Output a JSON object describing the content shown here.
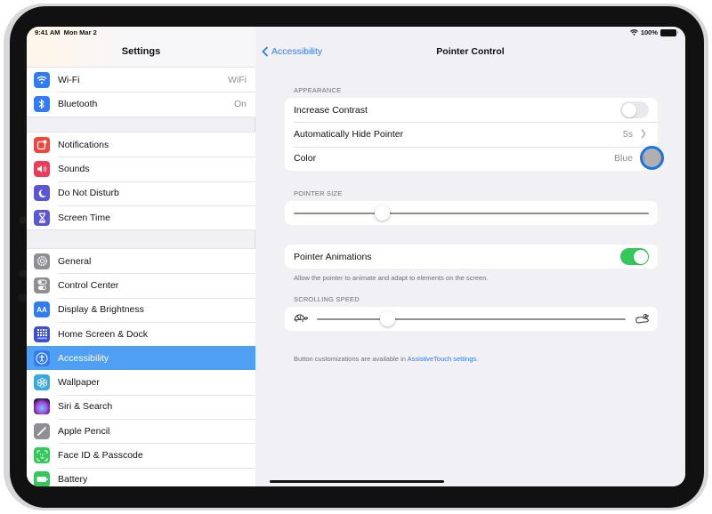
{
  "status_bar": {
    "time": "9:41 AM",
    "date": "Mon Mar 2",
    "battery_percent": "100%",
    "wifi_icon": "wifi-icon",
    "battery_icon": "battery-icon"
  },
  "sidebar": {
    "title": "Settings",
    "groups": [
      [
        {
          "label": "Wi-Fi",
          "value": "WiFi",
          "icon": "wifi-icon",
          "color": "#2f7cf6"
        },
        {
          "label": "Bluetooth",
          "value": "On",
          "icon": "bluetooth-icon",
          "color": "#2f7cf6"
        }
      ],
      [
        {
          "label": "Notifications",
          "icon": "notifications-icon",
          "color": "#f2453d"
        },
        {
          "label": "Sounds",
          "icon": "speaker-icon",
          "color": "#f03a5a"
        },
        {
          "label": "Do Not Disturb",
          "icon": "moon-icon",
          "color": "#5b56d6"
        },
        {
          "label": "Screen Time",
          "icon": "hourglass-icon",
          "color": "#5b56d6"
        }
      ],
      [
        {
          "label": "General",
          "icon": "gear-icon",
          "color": "#8e8e93"
        },
        {
          "label": "Control Center",
          "icon": "switches-icon",
          "color": "#8e8e93"
        },
        {
          "label": "Display & Brightness",
          "icon": "text-size-icon",
          "color": "#2f7cf6"
        },
        {
          "label": "Home Screen & Dock",
          "icon": "app-grid-icon",
          "color": "#3a4fd4"
        },
        {
          "label": "Accessibility",
          "icon": "accessibility-icon",
          "color": "#2f7cf6",
          "selected": true
        },
        {
          "label": "Wallpaper",
          "icon": "flower-icon",
          "color": "#35a9e0"
        },
        {
          "label": "Siri & Search",
          "icon": "siri-icon",
          "color": "#2a2a60"
        },
        {
          "label": "Apple Pencil",
          "icon": "pencil-icon",
          "color": "#8e8e93"
        },
        {
          "label": "Face ID & Passcode",
          "icon": "face-id-icon",
          "color": "#34c759"
        },
        {
          "label": "Battery",
          "icon": "battery-icon",
          "color": "#34c759"
        }
      ]
    ]
  },
  "detail": {
    "back_label": "Accessibility",
    "title": "Pointer Control",
    "appearance": {
      "header": "APPEARANCE",
      "increase_contrast": {
        "label": "Increase Contrast",
        "on": false
      },
      "auto_hide": {
        "label": "Automatically Hide Pointer",
        "value": "5s"
      },
      "color": {
        "label": "Color",
        "value": "Blue"
      }
    },
    "pointer_size": {
      "header": "POINTER SIZE",
      "value_fraction": 0.25
    },
    "pointer_animations": {
      "label": "Pointer Animations",
      "on": true,
      "footnote": "Allow the pointer to animate and adapt to elements on the screen."
    },
    "scrolling_speed": {
      "header": "SCROLLING SPEED",
      "value_fraction": 0.23,
      "min_icon": "turtle-icon",
      "max_icon": "rabbit-icon"
    },
    "footer": {
      "text": "Button customizations are available in ",
      "link": "AssistiveTouch settings",
      "suffix": "."
    }
  },
  "colors": {
    "accent": "#2f7cf6",
    "toggle_on": "#34c759",
    "selected_row": "#4f9ff5"
  }
}
